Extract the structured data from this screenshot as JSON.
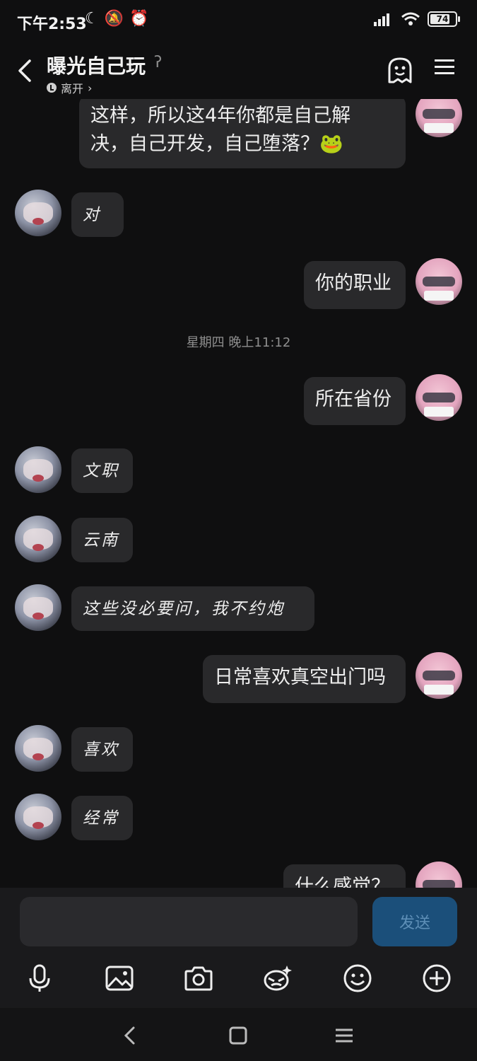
{
  "status_bar": {
    "time": "下午2:53",
    "battery": "74"
  },
  "header": {
    "title": "曝光自己玩",
    "presence": "离开"
  },
  "chat": {
    "messages": [
      {
        "side": "right",
        "text_line1": "这样，所以这4年你都是自己解",
        "text_line2": "决，自己开发，自己堕落？🐸"
      },
      {
        "side": "left",
        "text": "对"
      },
      {
        "side": "right",
        "text": "你的职业"
      },
      {
        "side": "left",
        "text": "文职"
      },
      {
        "side": "left",
        "text": "云南"
      },
      {
        "side": "left",
        "text": "这些没必要问，我不约炮"
      },
      {
        "side": "right",
        "text": "日常喜欢真空出门吗"
      },
      {
        "side": "left",
        "text": "喜欢"
      },
      {
        "side": "left",
        "text": "经常"
      },
      {
        "side": "right",
        "text": "什么感觉？"
      },
      {
        "side": "right",
        "text": "所在省份"
      }
    ],
    "timestamp": "星期四 晚上11:12"
  },
  "input": {
    "send_label": "发送",
    "placeholder": ""
  },
  "toolbar": {
    "icons": [
      "microphone-icon",
      "image-icon",
      "camera-icon",
      "effects-icon",
      "emoji-icon",
      "plus-icon"
    ]
  },
  "colors": {
    "background": "#0f0f10",
    "bubble": "#29292b",
    "send_button": "#1b4f7a"
  }
}
